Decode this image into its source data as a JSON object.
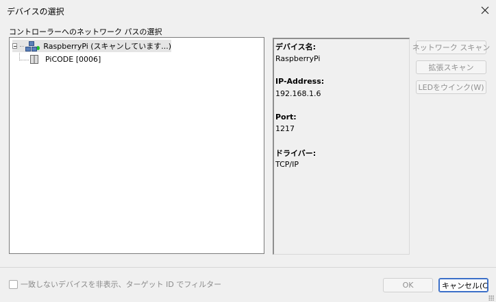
{
  "window": {
    "title": "デバイスの選択",
    "close_icon": "close-icon"
  },
  "tree": {
    "label": "コントローラーへのネットワーク パスの選択",
    "root": {
      "label": "RaspberryPi (スキャンしています...)",
      "icon": "network-icon",
      "status_color": "#1fbf2b"
    },
    "children": [
      {
        "label": "PiCODE [0006]",
        "icon": "plc-device-icon"
      }
    ]
  },
  "info": {
    "device_name_label": "デバイス名:",
    "device_name_value": "RaspberryPi",
    "ip_label": "IP-Address:",
    "ip_value": "192.168.1.6",
    "port_label": "Port:",
    "port_value": "1217",
    "driver_label": "ドライバー:",
    "driver_value": "TCP/IP"
  },
  "buttons": {
    "network_scan": "ネットワーク スキャン",
    "extended_scan": "拡張スキャン",
    "blink_led": "LEDをウインク(W)",
    "ok": "OK",
    "cancel": "キャンセル(C"
  },
  "filter": {
    "label": "一致しないデバイスを非表示、ターゲット ID でフィルター",
    "checked": false
  },
  "colors": {
    "selection": "#e5e5e5",
    "focus_border": "#3b6fc8",
    "disabled_text": "#8f8f8f"
  }
}
